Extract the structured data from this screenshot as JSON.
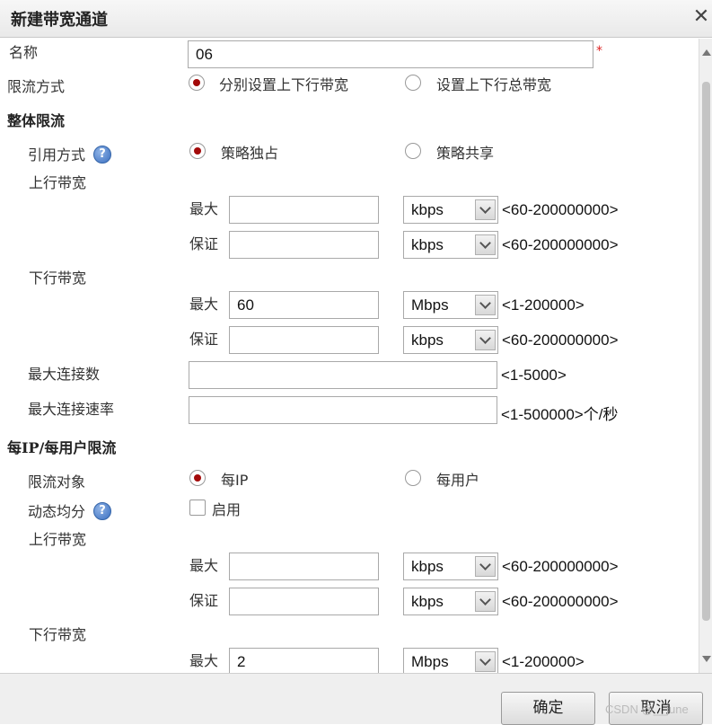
{
  "dialog": {
    "title": "新建带宽通道",
    "close_icon": "close-icon"
  },
  "name": {
    "label": "名称",
    "value": "06",
    "required_mark": "*"
  },
  "limit_mode": {
    "label": "限流方式",
    "options": [
      {
        "label": "分别设置上下行带宽",
        "selected": true
      },
      {
        "label": "设置上下行总带宽",
        "selected": false
      }
    ]
  },
  "overall": {
    "title": "整体限流",
    "ref_mode": {
      "label": "引用方式",
      "help_icon": "help-icon",
      "options": [
        {
          "label": "策略独占",
          "selected": true
        },
        {
          "label": "策略共享",
          "selected": false
        }
      ]
    },
    "upstream": {
      "label": "上行带宽",
      "max": {
        "label": "最大",
        "value": "",
        "unit": "kbps",
        "range": "<60-200000000>"
      },
      "guarantee": {
        "label": "保证",
        "value": "",
        "unit": "kbps",
        "range": "<60-200000000>"
      }
    },
    "downstream": {
      "label": "下行带宽",
      "max": {
        "label": "最大",
        "value": "60",
        "unit": "Mbps",
        "range": "<1-200000>"
      },
      "guarantee": {
        "label": "保证",
        "value": "",
        "unit": "kbps",
        "range": "<60-200000000>"
      }
    },
    "max_conn": {
      "label": "最大连接数",
      "value": "",
      "range": "<1-5000>"
    },
    "max_conn_rate": {
      "label": "最大连接速率",
      "value": "",
      "range": "<1-500000>个/秒"
    }
  },
  "per_ip": {
    "title": "每IP/每用户限流",
    "target": {
      "label": "限流对象",
      "options": [
        {
          "label": "每IP",
          "selected": true
        },
        {
          "label": "每用户",
          "selected": false
        }
      ]
    },
    "dynamic": {
      "label": "动态均分",
      "help_icon": "help-icon",
      "checkbox_label": "启用",
      "checked": false
    },
    "upstream": {
      "label": "上行带宽",
      "max": {
        "label": "最大",
        "value": "",
        "unit": "kbps",
        "range": "<60-200000000>"
      },
      "guarantee": {
        "label": "保证",
        "value": "",
        "unit": "kbps",
        "range": "<60-200000000>"
      }
    },
    "downstream": {
      "label": "下行带宽",
      "max": {
        "label": "最大",
        "value": "2",
        "unit": "Mbps",
        "range": "<1-200000>"
      }
    }
  },
  "footer": {
    "ok": "确定",
    "cancel": "取消"
  },
  "watermark": "CSDN @__june"
}
